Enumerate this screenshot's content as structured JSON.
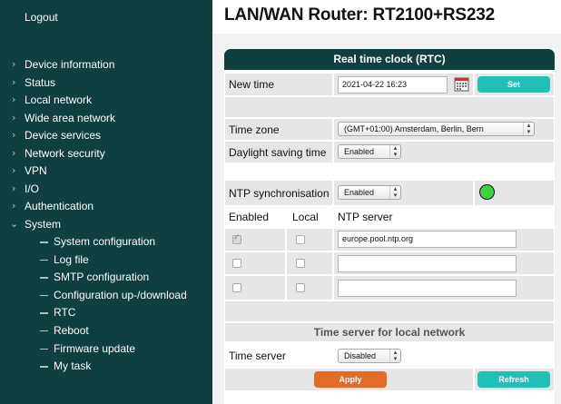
{
  "sidebar": {
    "logout": "Logout",
    "items": [
      {
        "label": "Device information"
      },
      {
        "label": "Status"
      },
      {
        "label": "Local network"
      },
      {
        "label": "Wide area network"
      },
      {
        "label": "Device services"
      },
      {
        "label": "Network security"
      },
      {
        "label": "VPN"
      },
      {
        "label": "I/O"
      },
      {
        "label": "Authentication"
      },
      {
        "label": "System"
      }
    ],
    "subitems": [
      {
        "label": "System configuration"
      },
      {
        "label": "Log file"
      },
      {
        "label": "SMTP configuration"
      },
      {
        "label": "Configuration up-/download"
      },
      {
        "label": "RTC"
      },
      {
        "label": "Reboot"
      },
      {
        "label": "Firmware update"
      },
      {
        "label": "My task"
      }
    ]
  },
  "header": {
    "title": "LAN/WAN Router: RT2100+RS232"
  },
  "rtc": {
    "title": "Real time clock (RTC)",
    "new_time_label": "New time",
    "new_time_value": "2021-04-22 16:23",
    "set_button": "Set",
    "timezone_label": "Time zone",
    "timezone_value": "(GMT+01:00) Amsterdam, Berlin, Bern",
    "dst_label": "Daylight saving time",
    "dst_value": "Enabled",
    "ntp_label": "NTP synchronisation",
    "ntp_value": "Enabled",
    "ntp_status_color": "#3cd33c",
    "col_enabled": "Enabled",
    "col_local": "Local",
    "col_server": "NTP server",
    "servers": [
      {
        "enabled": true,
        "local": false,
        "server": "europe.pool.ntp.org"
      },
      {
        "enabled": false,
        "local": false,
        "server": ""
      },
      {
        "enabled": false,
        "local": false,
        "server": ""
      }
    ],
    "local_section_title": "Time server for local network",
    "timeserver_label": "Time server",
    "timeserver_value": "Disabled",
    "apply_button": "Apply",
    "refresh_button": "Refresh"
  },
  "colors": {
    "sidebar": "#0f3f3f",
    "accent_teal": "#1fc1b6",
    "accent_orange": "#e46a27"
  },
  "icons": {
    "nav_collapsed": "chevron-right-icon",
    "nav_expanded": "chevron-down-icon",
    "calendar": "calendar-icon"
  }
}
